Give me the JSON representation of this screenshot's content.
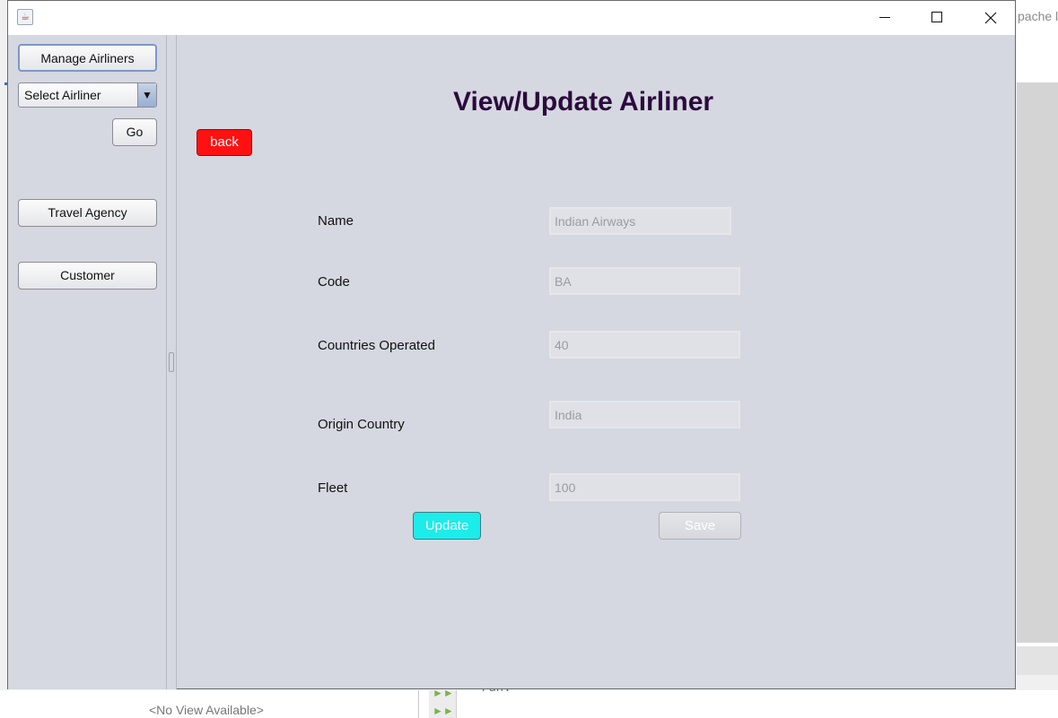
{
  "background": {
    "apache_fragment": "pache l",
    "no_view": "<No View Available>",
    "code_fragment": "run:"
  },
  "window": {
    "icon": "java-cup-icon",
    "controls": {
      "minimize": "minimize-icon",
      "maximize": "maximize-icon",
      "close": "close-icon"
    }
  },
  "sidebar": {
    "manage_airliners": "Manage Airliners",
    "select_airliner": "Select Airliner",
    "go": "Go",
    "travel_agency": "Travel Agency",
    "customer": "Customer"
  },
  "main": {
    "title": "View/Update Airliner",
    "back": "back",
    "fields": {
      "name": {
        "label": "Name",
        "value": "Indian Airways"
      },
      "code": {
        "label": "Code",
        "value": "BA"
      },
      "countries": {
        "label": "Countries Operated",
        "value": "40"
      },
      "origin": {
        "label": "Origin Country",
        "value": "India"
      },
      "fleet": {
        "label": "Fleet",
        "value": "100"
      }
    },
    "update": "Update",
    "save": "Save"
  },
  "colors": {
    "panel_bg": "#d5d8e0",
    "title": "#2b0a3d",
    "back_button": "#ff1111",
    "update_button": "#1cecea"
  }
}
